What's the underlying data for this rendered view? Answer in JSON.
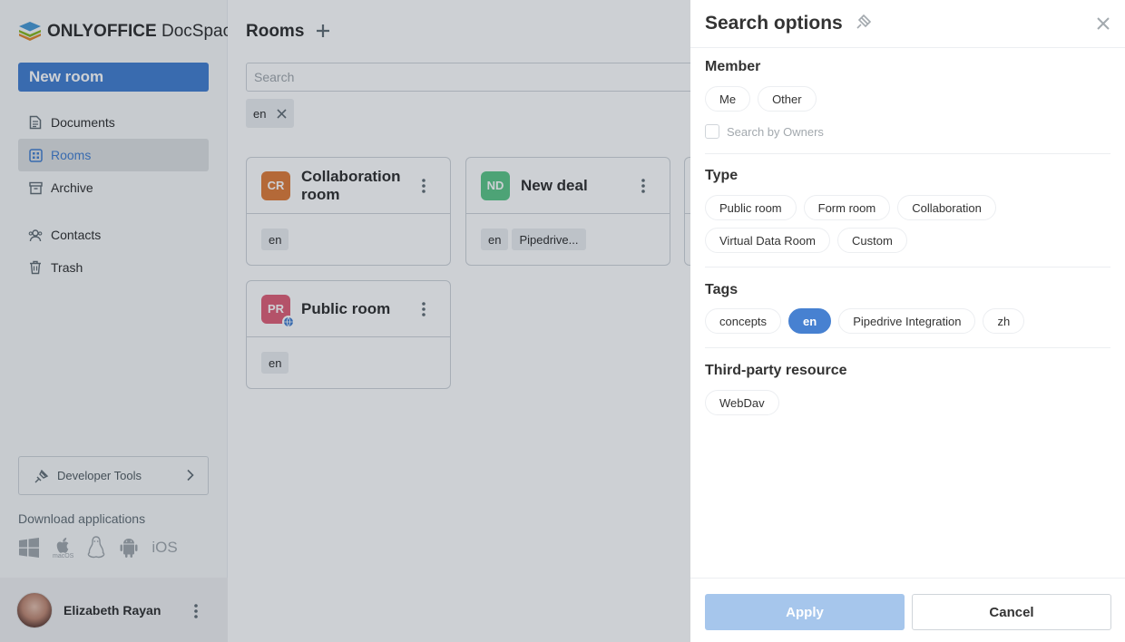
{
  "sidebar": {
    "logo_bold": "ONLYOFFICE",
    "logo_regular": " DocSpace",
    "new_room_label": "New room",
    "nav": {
      "documents": "Documents",
      "rooms": "Rooms",
      "archive": "Archive",
      "contacts": "Contacts",
      "trash": "Trash"
    },
    "developer_tools_label": "Developer Tools",
    "download_label": "Download applications",
    "apps": {
      "macos_label": "macOS",
      "ios_label": "iOS"
    },
    "user_name": "Elizabeth Rayan"
  },
  "main": {
    "title": "Rooms",
    "search_placeholder": "Search",
    "active_filter": "en",
    "rooms": [
      {
        "initials": "CR",
        "title": "Collaboration room",
        "color": "#e07f3d",
        "tags": [
          "en"
        ]
      },
      {
        "initials": "ND",
        "title": "New deal",
        "color": "#5fc78a",
        "tags": [
          "en",
          "Pipedrive..."
        ]
      },
      {
        "initials": "PR",
        "title": "Public room",
        "color": "#e0627a",
        "tags": [
          "en"
        ]
      }
    ]
  },
  "panel": {
    "title": "Search options",
    "member": {
      "title": "Member",
      "options": [
        "Me",
        "Other"
      ],
      "search_by_owners": "Search by Owners"
    },
    "type": {
      "title": "Type",
      "options": [
        "Public room",
        "Form room",
        "Collaboration",
        "Virtual Data Room",
        "Custom"
      ]
    },
    "tags": {
      "title": "Tags",
      "options": [
        "concepts",
        "en",
        "Pipedrive Integration",
        "zh"
      ],
      "selected": "en"
    },
    "third_party": {
      "title": "Third-party resource",
      "options": [
        "WebDav"
      ]
    },
    "apply_label": "Apply",
    "cancel_label": "Cancel"
  },
  "colors": {
    "accent": "#4781d1",
    "apply_disabled": "#a6c6ec"
  }
}
